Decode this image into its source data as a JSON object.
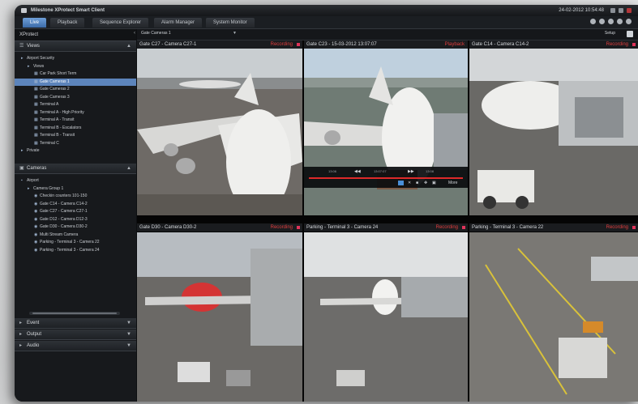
{
  "app": {
    "title": "Milestone XProtect Smart Client",
    "datetime": "24-02-2012 10:54:48"
  },
  "tabs": [
    {
      "label": "Live",
      "active": true
    },
    {
      "label": "Playback",
      "active": false
    },
    {
      "label": "Sequence Explorer",
      "active": false
    },
    {
      "label": "Alarm Manager",
      "active": false
    },
    {
      "label": "System Monitor",
      "active": false
    }
  ],
  "toolbar": {
    "brand": "XProtect",
    "view_selector": "Gate Cameras 1",
    "setup_label": "Setup"
  },
  "views_panel": {
    "header": "Views",
    "items": [
      {
        "label": "Airport Security",
        "indent": 0,
        "icon": "folder-icon"
      },
      {
        "label": "Views",
        "indent": 1,
        "icon": "folder-icon"
      },
      {
        "label": "Car Park Short Term",
        "indent": 2,
        "icon": "view-icon"
      },
      {
        "label": "Gate Cameras 1",
        "indent": 2,
        "icon": "view-icon",
        "selected": true
      },
      {
        "label": "Gate Cameras 2",
        "indent": 2,
        "icon": "view-icon"
      },
      {
        "label": "Gate Cameras 3",
        "indent": 2,
        "icon": "view-icon"
      },
      {
        "label": "Terminal A",
        "indent": 2,
        "icon": "view-icon"
      },
      {
        "label": "Terminal A - High Priority",
        "indent": 2,
        "icon": "view-icon"
      },
      {
        "label": "Terminal A - Transit",
        "indent": 2,
        "icon": "view-icon"
      },
      {
        "label": "Terminal B - Escalators",
        "indent": 2,
        "icon": "view-icon"
      },
      {
        "label": "Terminal B - Transit",
        "indent": 2,
        "icon": "view-icon"
      },
      {
        "label": "Terminal C",
        "indent": 2,
        "icon": "view-icon"
      },
      {
        "label": "Private",
        "indent": 0,
        "icon": "folder-icon"
      }
    ]
  },
  "cameras_panel": {
    "header": "Cameras",
    "items": [
      {
        "label": "Airport",
        "indent": 0,
        "icon": "server-icon"
      },
      {
        "label": "Camera Group 1",
        "indent": 1,
        "icon": "folder-icon"
      },
      {
        "label": "Checkin counters 101-150",
        "indent": 2,
        "icon": "camera-icon"
      },
      {
        "label": "Gate C14 - Camera C14-2",
        "indent": 2,
        "icon": "camera-icon"
      },
      {
        "label": "Gate C27 - Camera C27-1",
        "indent": 2,
        "icon": "camera-icon"
      },
      {
        "label": "Gate D12 - Camera D12-3",
        "indent": 2,
        "icon": "camera-icon"
      },
      {
        "label": "Gate D30 - Camera D30-2",
        "indent": 2,
        "icon": "camera-icon"
      },
      {
        "label": "Multi Stream Camera",
        "indent": 2,
        "icon": "camera-icon"
      },
      {
        "label": "Parking - Terminal 3 - Camera 22",
        "indent": 2,
        "icon": "camera-icon"
      },
      {
        "label": "Parking - Terminal 3 - Camera 24",
        "indent": 2,
        "icon": "camera-icon"
      }
    ]
  },
  "collapsed_panels": [
    {
      "label": "Event",
      "icon": "event-icon"
    },
    {
      "label": "Output",
      "icon": "output-icon"
    },
    {
      "label": "Audio",
      "icon": "audio-icon"
    }
  ],
  "cameras": [
    {
      "title": "Gate C27 - Camera C27-1",
      "status": "Recording",
      "style": "white"
    },
    {
      "title": "Gate C23 - 15-03-2012 13:07:07",
      "status": "Playback",
      "style": "amber"
    },
    {
      "title": "Gate C14 - Camera C14-2",
      "status": "Recording",
      "style": "dark"
    },
    {
      "title": "Gate D30 - Camera D30-2",
      "status": "Recording",
      "style": "dark"
    },
    {
      "title": "Parking - Terminal 3 - Camera 24",
      "status": "Recording",
      "style": "dark"
    },
    {
      "title": "Parking - Terminal 3 - Camera 22",
      "status": "Recording",
      "style": "dark"
    }
  ],
  "playback": {
    "time_left": "13:06",
    "time_center": "13:07:07",
    "time_right": "13:08",
    "more_label": "More"
  },
  "colors": {
    "accent_blue": "#4a7fc1",
    "recording_red": "#e03d3d",
    "playback_amber": "#efb233"
  }
}
